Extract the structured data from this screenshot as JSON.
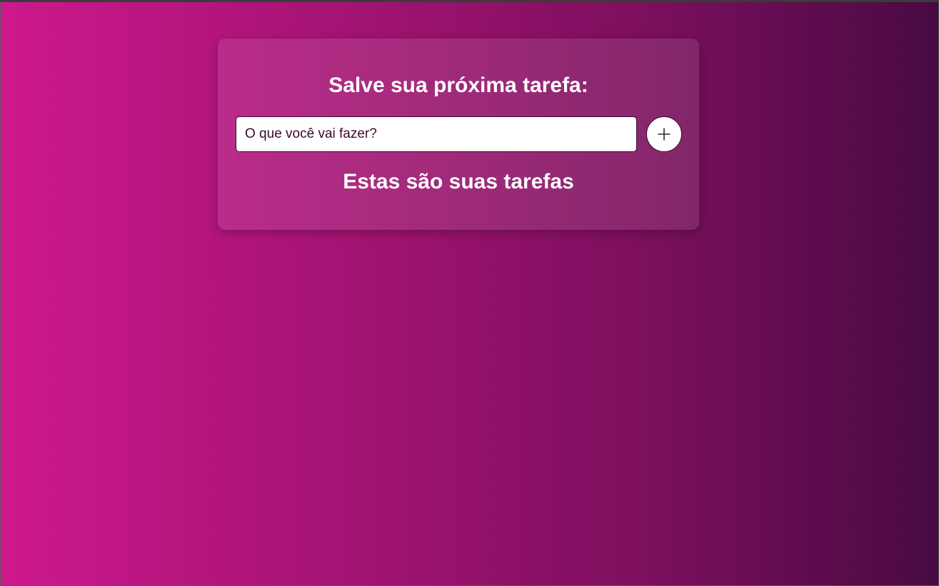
{
  "form": {
    "title": "Salve sua próxima tarefa:",
    "input_value": "",
    "input_placeholder": "O que você vai fazer?",
    "add_icon": "plus-icon"
  },
  "tasks": {
    "heading": "Estas são suas tarefas",
    "items": []
  },
  "colors": {
    "gradient_start": "#cd188d",
    "gradient_end": "#480a43",
    "text": "#ffffff",
    "input_text": "#3a0a2d"
  }
}
